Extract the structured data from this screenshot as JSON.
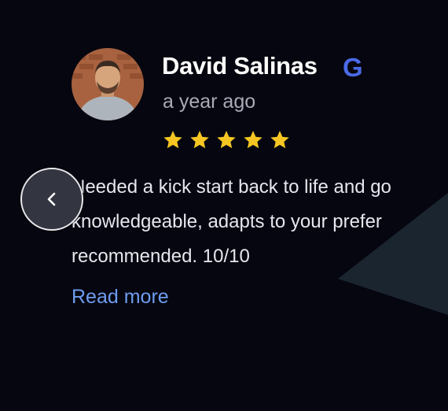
{
  "review": {
    "author_name": "David Salinas",
    "source_icon": "google-g-icon",
    "source_letter": "G",
    "time_ago": "a year ago",
    "rating": 5,
    "rating_max": 5,
    "text_lines": [
      "Needed a kick start back to life and go",
      "knowledgeable, adapts to your prefer",
      "recommended. 10/10"
    ],
    "read_more_label": "Read more"
  },
  "carousel": {
    "prev_icon": "chevron-left-icon"
  },
  "colors": {
    "background": "#05060f",
    "star": "#f5c623",
    "google_blue": "#4a6ae8",
    "link": "#6f9cf0",
    "decor_shape": "#1b2530"
  }
}
